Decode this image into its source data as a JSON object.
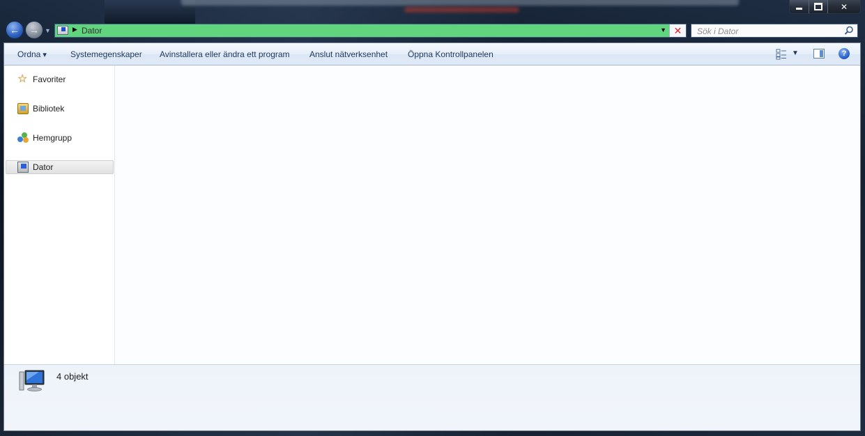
{
  "address": {
    "path": "Dator"
  },
  "search": {
    "placeholder": "Sök i Dator"
  },
  "toolbar": {
    "organize": "Ordna",
    "system_properties": "Systemegenskaper",
    "uninstall": "Avinstallera eller ändra ett program",
    "map_network": "Anslut nätverksenhet",
    "control_panel": "Öppna Kontrollpanelen",
    "help": "?"
  },
  "nav_pane": {
    "items": [
      {
        "label": "Favoriter",
        "icon": "star-icon"
      },
      {
        "label": "Bibliotek",
        "icon": "library-icon"
      },
      {
        "label": "Hemgrupp",
        "icon": "homegroup-icon"
      },
      {
        "label": "Dator",
        "icon": "computer-icon",
        "selected": true
      }
    ]
  },
  "details": {
    "count": "4 objekt"
  },
  "colors": {
    "address_bar": "#61d57e",
    "window_bg": "#fcfdfe",
    "toolbar_text": "#1e395b"
  }
}
